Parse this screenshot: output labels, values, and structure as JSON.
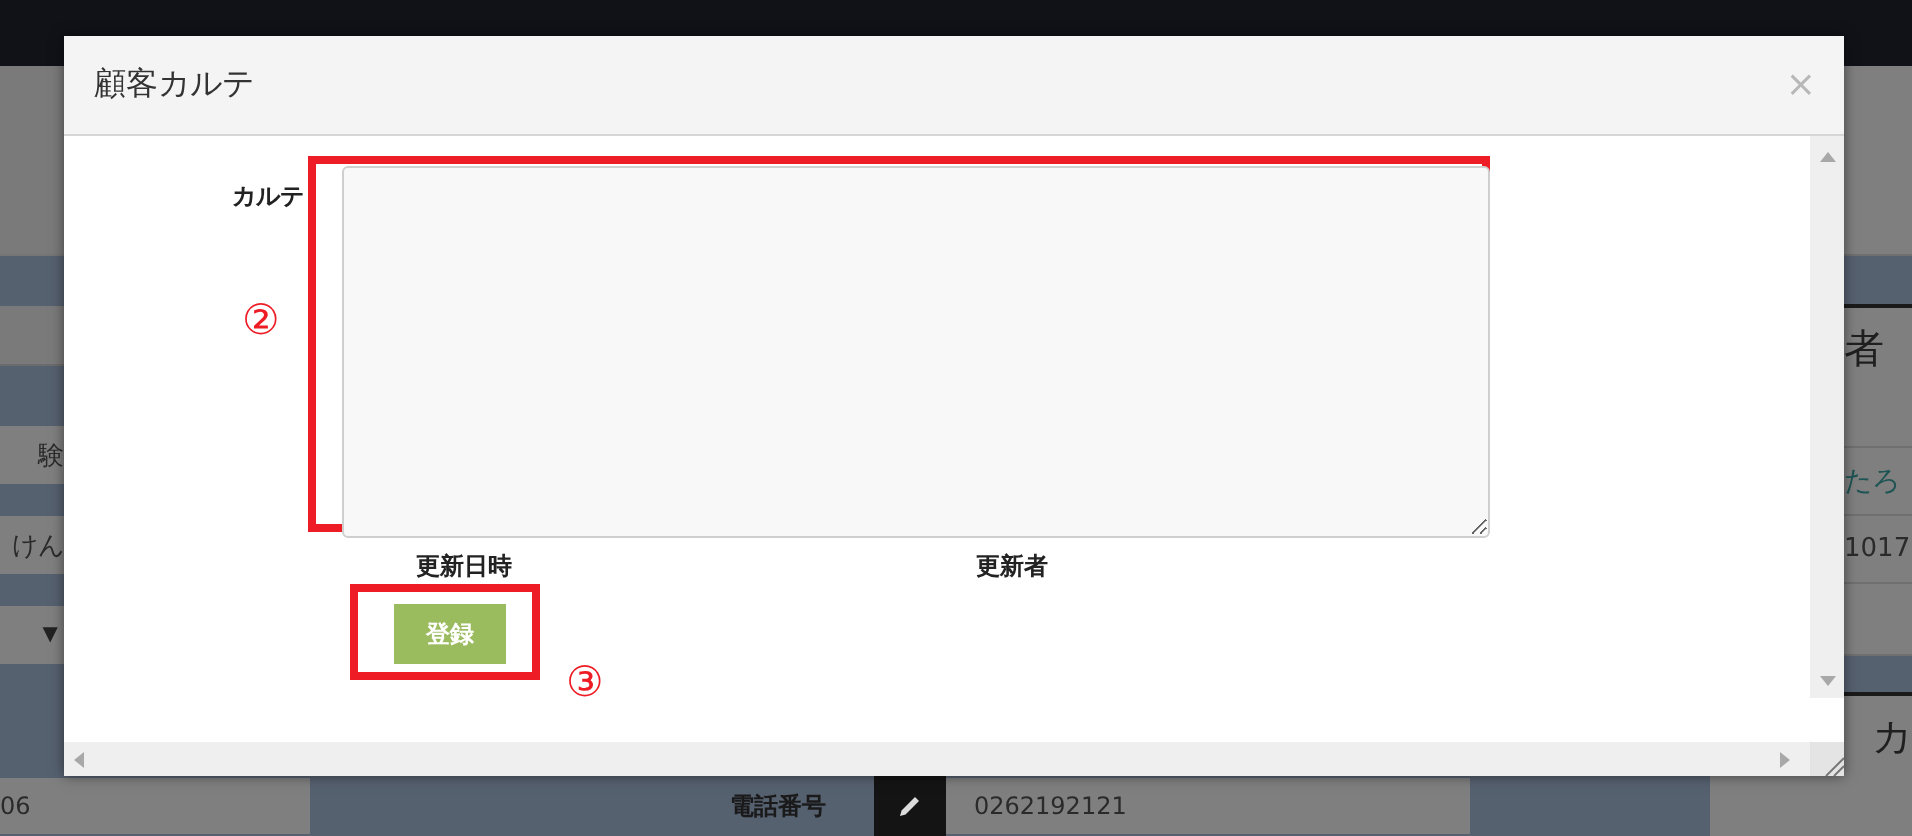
{
  "background_page": {
    "left_column": [
      {
        "kind": "blank"
      },
      {
        "kind": "band"
      },
      {
        "kind": "blank"
      },
      {
        "kind": "band"
      },
      {
        "kind": "text",
        "text": "験"
      },
      {
        "kind": "band"
      },
      {
        "kind": "text",
        "text": "けん"
      },
      {
        "kind": "band"
      },
      {
        "kind": "caret",
        "text": "▼"
      },
      {
        "kind": "band"
      }
    ],
    "right_column": [
      {
        "kind": "blank"
      },
      {
        "kind": "band"
      },
      {
        "kind": "heading",
        "text": "者"
      },
      {
        "kind": "blank"
      },
      {
        "kind": "link",
        "text": "たろ"
      },
      {
        "kind": "text",
        "text": "1017"
      },
      {
        "kind": "blank"
      },
      {
        "kind": "band"
      },
      {
        "kind": "heading",
        "text": "カ"
      }
    ],
    "bottom_row": {
      "field_value": "06",
      "label": "電話番号",
      "phone_value": "0262192121"
    }
  },
  "modal": {
    "title": "顧客カルテ",
    "close": "×",
    "field_label": "カルテ",
    "meta_labels": [
      "更新日時",
      "更新者"
    ],
    "button": "登録",
    "annotations": [
      "②",
      "③"
    ]
  }
}
